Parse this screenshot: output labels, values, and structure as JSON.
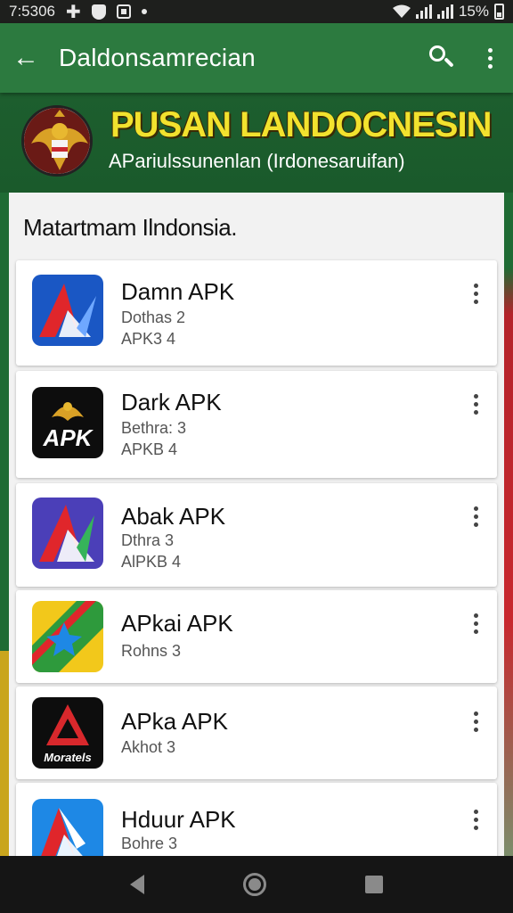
{
  "status_bar": {
    "time": "7:5306",
    "battery": "15%",
    "icons": [
      "plus-icon",
      "shield-icon",
      "square-icon",
      "dot-icon",
      "wifi-icon",
      "signal-icon",
      "battery-icon"
    ]
  },
  "app_bar": {
    "title": "Daldonsamrecian",
    "icons": [
      "back-arrow-icon",
      "search-icon",
      "more-vert-icon"
    ]
  },
  "banner": {
    "title": "PUSAN LANDOCNESIN",
    "subtitle": "APariulssunenlan (Irdonesaruifan)"
  },
  "section": {
    "title": "Matartmam Ilndonsia."
  },
  "apps": [
    {
      "name": "Damn APK",
      "line1": "Dothas 2",
      "line2": "APK3 4",
      "icon": "blue-triangle-icon",
      "colors": [
        "#1a57c4",
        "#e0262b"
      ]
    },
    {
      "name": "Dark APK",
      "line1": "Bethra: 3",
      "line2": "APKB 4",
      "icon": "garuda-apk-icon",
      "icon_text": "APK",
      "colors": [
        "#0d0d0d",
        "#d8282c"
      ]
    },
    {
      "name": "Abak APK",
      "line1": "Dthra 3",
      "line2": "AlPKB 4",
      "icon": "purple-triangle-icon",
      "colors": [
        "#4b3fb8",
        "#e0262b"
      ]
    },
    {
      "name": "APkai APK",
      "line1": "Rohns 3",
      "line2": "",
      "icon": "green-yellow-star-icon",
      "colors": [
        "#f2c81b",
        "#2e9a3c"
      ]
    },
    {
      "name": "APka APK",
      "line1": "Akhot 3",
      "line2": "",
      "icon": "red-triangle-icon",
      "icon_text": "Moratels",
      "colors": [
        "#0d0d0d",
        "#d8282c"
      ]
    },
    {
      "name": "Hduur APK",
      "line1": "Bohre 3",
      "line2": "",
      "icon": "blue-triangle-icon",
      "colors": [
        "#1e88e5",
        "#e0262b"
      ]
    }
  ],
  "nav_bar": {
    "icons": [
      "nav-back-icon",
      "nav-home-icon",
      "nav-recents-icon"
    ]
  }
}
